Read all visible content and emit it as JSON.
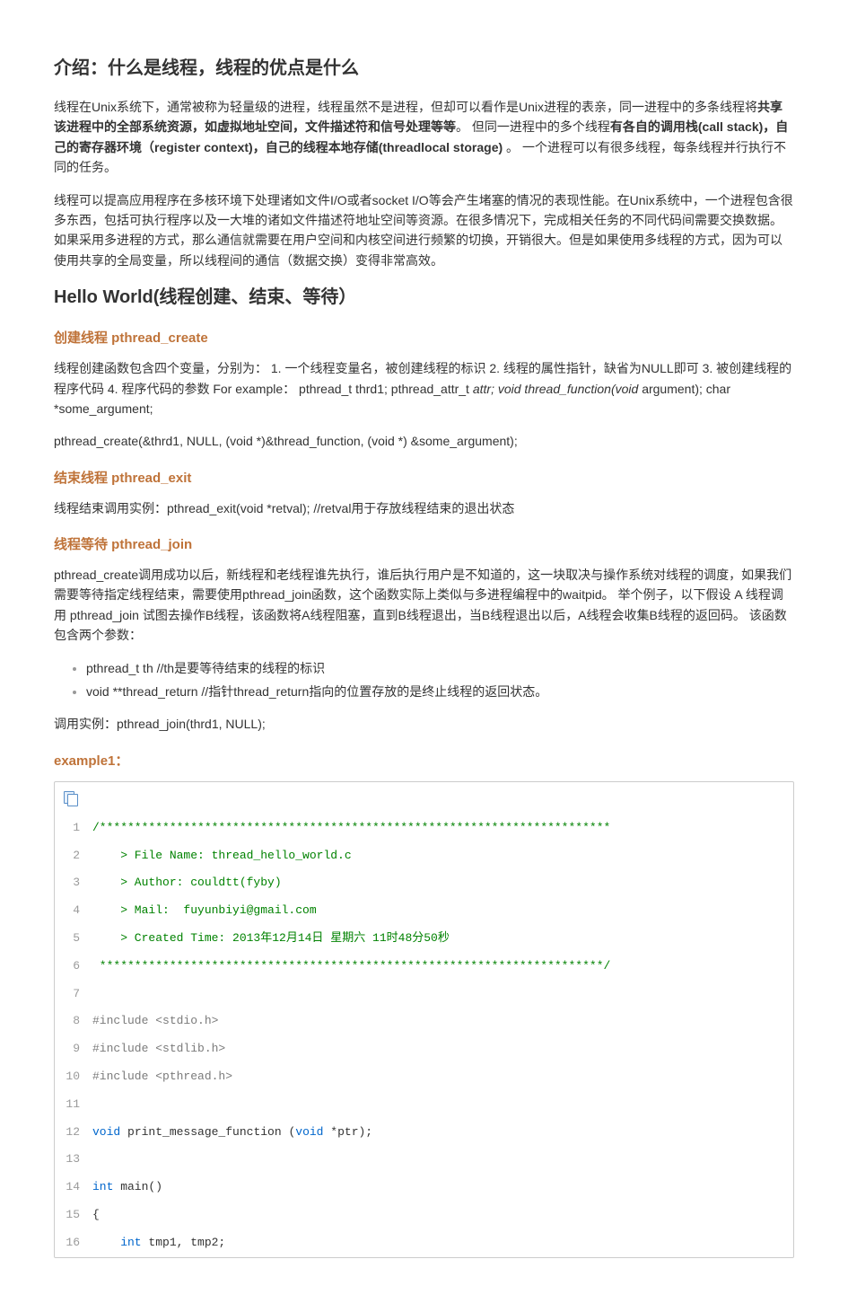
{
  "h1": "介绍：什么是线程，线程的优点是什么",
  "p1a": "线程在Unix系统下，通常被称为轻量级的进程，线程虽然不是进程，但却可以看作是Unix进程的表亲，同一进程中的多条线程将",
  "p1b": "共享该进程中的全部系统资源，如虚拟地址空间，文件描述符和信号处理等等",
  "p1c": "。 但同一进程中的多个线程",
  "p1d": "有各自的调用栈(call stack)，自己的寄存器环境（register context)，自己的线程本地存储(threadlocal storage)",
  "p1e": " 。  一个进程可以有很多线程，每条线程并行执行不同的任务。",
  "p2": "线程可以提高应用程序在多核环境下处理诸如文件I/O或者socket I/O等会产生堵塞的情况的表现性能。在Unix系统中，一个进程包含很多东西，包括可执行程序以及一大堆的诸如文件描述符地址空间等资源。在很多情况下，完成相关任务的不同代码间需要交换数据。如果采用多进程的方式，那么通信就需要在用户空间和内核空间进行频繁的切换，开销很大。但是如果使用多线程的方式，因为可以使用共享的全局变量，所以线程间的通信（数据交换）变得非常高效。",
  "h2": "Hello World(线程创建、结束、等待）",
  "sec1": {
    "title": "创建线程 pthread_create",
    "p1a": "线程创建函数包含四个变量，分别为： 1. 一个线程变量名，被创建线程的标识 2. 线程的属性指针，缺省为NULL即可 3. 被创建线程的程序代码 4. 程序代码的参数 For example： pthread_t thrd1; pthread_attr_t ",
    "p1b": "attr;  void thread_function(void ",
    "p1c": " argument);  char *some_argument;",
    "p2": "pthread_create(&thrd1, NULL, (void *)&thread_function, (void *) &some_argument);"
  },
  "sec2": {
    "title": "结束线程 pthread_exit",
    "p1": "线程结束调用实例：pthread_exit(void *retval); //retval用于存放线程结束的退出状态"
  },
  "sec3": {
    "title": "线程等待 pthread_join",
    "p1": "pthread_create调用成功以后，新线程和老线程谁先执行，谁后执行用户是不知道的，这一块取决与操作系统对线程的调度，如果我们需要等待指定线程结束，需要使用pthread_join函数，这个函数实际上类似与多进程编程中的waitpid。 举个例子，以下假设 A 线程调用 pthread_join 试图去操作B线程，该函数将A线程阻塞，直到B线程退出，当B线程退出以后，A线程会收集B线程的返回码。 该函数包含两个参数：",
    "li1": "pthread_t th //th是要等待结束的线程的标识",
    "li2": "void **thread_return //指针thread_return指向的位置存放的是终止线程的返回状态。",
    "p2": "调用实例：pthread_join(thrd1, NULL);"
  },
  "sec4": {
    "title": "example1："
  },
  "code": {
    "l1": "/*************************************************************************",
    "l2": "    > File Name: thread_hello_world.c",
    "l3": "    > Author: couldtt(fyby)",
    "l4": "    > Mail:  fuyunbiyi@gmail.com",
    "l5": "    > Created Time: 2013年12月14日 星期六 11时48分50秒",
    "l6": " ************************************************************************/",
    "l7": "",
    "l8a": "#include <stdio.h>",
    "l9a": "#include <stdlib.h>",
    "l10a": "#include <pthread.h>",
    "l11": "",
    "l12_kw": "void",
    "l12_id": " print_message_function (",
    "l12_kw2": "void",
    "l12_id2": " *ptr);",
    "l13": "",
    "l14_kw": "int",
    "l14_id": " main()",
    "l15": "{",
    "l16_kw": "    int",
    "l16_id": " tmp1, tmp2;"
  }
}
